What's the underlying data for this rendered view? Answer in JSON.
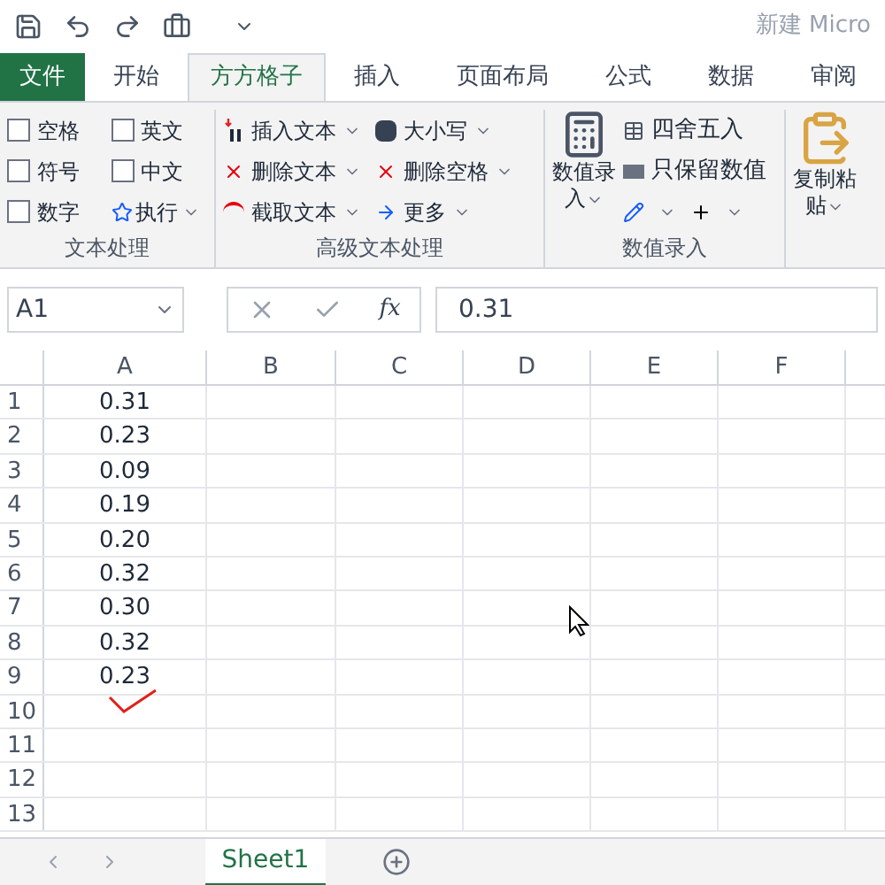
{
  "title_bar": {
    "document_title": "新建 Micro"
  },
  "tabs": [
    {
      "label": "文件",
      "kind": "file",
      "selected": false
    },
    {
      "label": "开始",
      "kind": "normal",
      "selected": false
    },
    {
      "label": "方方格子",
      "kind": "normal",
      "selected": true
    },
    {
      "label": "插入",
      "kind": "normal",
      "selected": false
    },
    {
      "label": "页面布局",
      "kind": "normal",
      "selected": false
    },
    {
      "label": "公式",
      "kind": "normal",
      "selected": false
    },
    {
      "label": "数据",
      "kind": "normal",
      "selected": false
    },
    {
      "label": "审阅",
      "kind": "normal",
      "selected": false
    }
  ],
  "ribbon": {
    "text_group": {
      "label": "文本处理",
      "checkboxes": [
        {
          "label": "空格",
          "checked": false
        },
        {
          "label": "英文",
          "checked": false
        },
        {
          "label": "符号",
          "checked": false
        },
        {
          "label": "中文",
          "checked": false
        },
        {
          "label": "数字",
          "checked": false
        }
      ],
      "execute": "执行"
    },
    "advanced_group": {
      "label": "高级文本处理",
      "commands": [
        "插入文本",
        "删除文本",
        "截取文本",
        "大小写",
        "删除空格",
        "更多"
      ]
    },
    "number_group": {
      "label": "数值录入",
      "big_button": [
        "数值录",
        "入"
      ],
      "commands": [
        "四舍五入",
        "只保留数值"
      ]
    },
    "paste_button": [
      "复制粘",
      "贴"
    ]
  },
  "formula_bar": {
    "name_box": "A1",
    "function_label": "fx",
    "formula": "0.31"
  },
  "sheet": {
    "columns": [
      "A",
      "B",
      "C",
      "D",
      "E",
      "F"
    ],
    "rows": [
      {
        "number": "1",
        "a": "0.31"
      },
      {
        "number": "2",
        "a": "0.23"
      },
      {
        "number": "3",
        "a": "0.09"
      },
      {
        "number": "4",
        "a": "0.19"
      },
      {
        "number": "5",
        "a": "0.20"
      },
      {
        "number": "6",
        "a": "0.32"
      },
      {
        "number": "7",
        "a": "0.30"
      },
      {
        "number": "8",
        "a": "0.32"
      },
      {
        "number": "9",
        "a": "0.23"
      },
      {
        "number": "10"
      },
      {
        "number": "11"
      },
      {
        "number": "12"
      },
      {
        "number": "13"
      }
    ]
  },
  "sheet_tabs": [
    {
      "label": "Sheet1",
      "selected": true
    }
  ]
}
